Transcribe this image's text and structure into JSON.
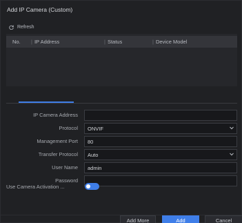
{
  "dialog": {
    "title": "Add IP Camera (Custom)"
  },
  "toolbar": {
    "refresh_label": "Refresh"
  },
  "table": {
    "headers": [
      "No.",
      "IP Address",
      "Status",
      "Device Model"
    ]
  },
  "form": {
    "ip_address": {
      "label": "IP Camera Address",
      "value": ""
    },
    "protocol": {
      "label": "Protocol",
      "value": "ONVIF"
    },
    "management_port": {
      "label": "Management Port",
      "value": "80"
    },
    "transfer_protocol": {
      "label": "Transfer Protocol",
      "value": "Auto"
    },
    "user_name": {
      "label": "User Name",
      "value": "admin"
    },
    "password": {
      "label": "Password",
      "value": ""
    },
    "activation": {
      "label": "Use Camera Activation ...",
      "enabled": true
    }
  },
  "buttons": {
    "add_more": "Add More",
    "add": "Add",
    "cancel": "Cancel"
  },
  "colors": {
    "accent": "#3f7ee8",
    "background": "#202124"
  }
}
